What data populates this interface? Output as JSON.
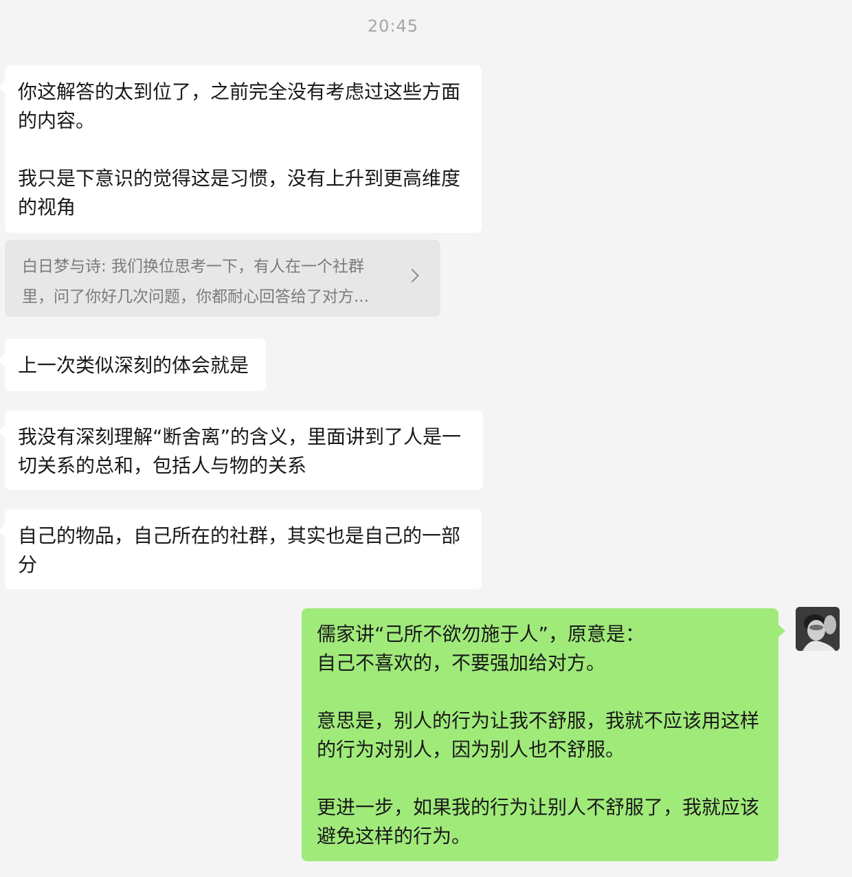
{
  "chat": {
    "timestamp": "20:45",
    "messages": [
      {
        "side": "incoming",
        "text": "你这解答的太到位了，之前完全没有考虑过这些方面的内容。\n\n我只是下意识的觉得这是习惯，没有上升到更高维度的视角"
      },
      {
        "side": "incoming",
        "type": "quote",
        "text": "白日梦与诗: 我们换位思考一下，有人在一个社群里，问了你好几次问题，你都耐心回答给了对方..."
      },
      {
        "side": "incoming",
        "text": "上一次类似深刻的体会就是"
      },
      {
        "side": "incoming",
        "text": "我没有深刻理解“断舍离”的含义，里面讲到了人是一切关系的总和，包括人与物的关系"
      },
      {
        "side": "incoming",
        "text": "自己的物品，自己所在的社群，其实也是自己的一部分"
      },
      {
        "side": "outgoing",
        "text": "儒家讲“己所不欲勿施于人”，原意是：\n自己不喜欢的，不要强加给对方。\n\n意思是，别人的行为让我不舒服，我就不应该用这样的行为对别人，因为别人也不舒服。\n\n更进一步，如果我的行为让别人不舒服了，我就应该避免这样的行为。"
      }
    ]
  },
  "colors": {
    "background": "#f4f4f4",
    "incoming_bubble": "#ffffff",
    "outgoing_bubble": "#a0ea7a",
    "quote_bubble": "#e7e7e7"
  },
  "icons": {
    "quote_expand": "chevron-right-icon",
    "user_avatar": "avatar"
  }
}
